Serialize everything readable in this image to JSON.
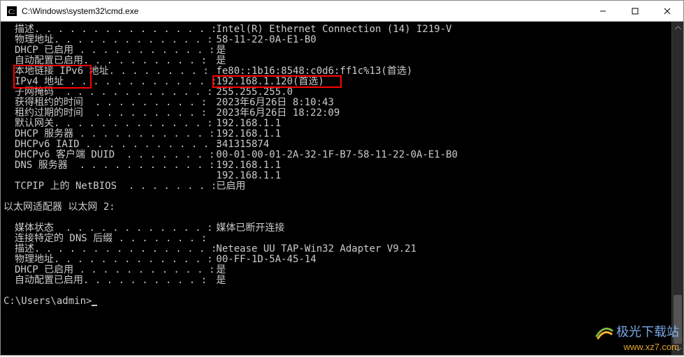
{
  "title": "C:\\Windows\\system32\\cmd.exe",
  "rows": [
    {
      "key": "描述",
      "dots": ". . . . . . . . . . . . . . . :",
      "val": "Intel(R) Ethernet Connection (14) I219-V"
    },
    {
      "key": "物理地址",
      "dots": ". . . . . . . . . . . . . :",
      "val": "58-11-22-0A-E1-B0"
    },
    {
      "key": "DHCP 已启用",
      "dots": " . . . . . . . . . . . :",
      "val": "是"
    },
    {
      "key": "自动配置已启用",
      "dots": ". . . . . . . . . . :",
      "val": "是"
    },
    {
      "key": "本地链接 IPv6 地址",
      "dots": ". . . . . . . . :",
      "val": "fe80::1b16:8548:c0d6:ff1c%13(首选)"
    },
    {
      "key": "IPv4 地址",
      "dots": " . . . . . . . . . . . . :",
      "val": "192.168.1.120(首选)"
    },
    {
      "key": "子网掩码",
      "dots": "  . . . . . . . . . . . . :",
      "val": "255.255.255.0"
    },
    {
      "key": "获得租约的时间",
      "dots": "  . . . . . . . . . :",
      "val": "2023年6月26日 8:10:43"
    },
    {
      "key": "租约过期的时间",
      "dots": "  . . . . . . . . . :",
      "val": "2023年6月26日 18:22:09"
    },
    {
      "key": "默认网关",
      "dots": ". . . . . . . . . . . . . :",
      "val": "192.168.1.1"
    },
    {
      "key": "DHCP 服务器",
      "dots": " . . . . . . . . . . . :",
      "val": "192.168.1.1"
    },
    {
      "key": "DHCPv6 IAID",
      "dots": " . . . . . . . . . . . :",
      "val": "341315874"
    },
    {
      "key": "DHCPv6 客户端 DUID",
      "dots": "  . . . . . . . :",
      "val": "00-01-00-01-2A-32-1F-B7-58-11-22-0A-E1-B0"
    },
    {
      "key": "DNS 服务器",
      "dots": "  . . . . . . . . . . . :",
      "val": "192.168.1.1"
    },
    {
      "key": "",
      "dots": "",
      "val": "192.168.1.1",
      "continuation": true
    },
    {
      "key": "TCPIP 上的 NetBIOS",
      "dots": "  . . . . . . . :",
      "val": "已启用"
    }
  ],
  "section2": "以太网适配器 以太网 2:",
  "rows2": [
    {
      "key": "媒体状态",
      "dots": "  . . . . . . . . . . . . :",
      "val": "媒体已断开连接"
    },
    {
      "key": "连接特定的 DNS 后缀",
      "dots": " . . . . . . . :",
      "val": ""
    },
    {
      "key": "描述",
      "dots": ". . . . . . . . . . . . . . . :",
      "val": "Netease UU TAP-Win32 Adapter V9.21"
    },
    {
      "key": "物理地址",
      "dots": ". . . . . . . . . . . . . :",
      "val": "00-FF-1D-5A-45-14"
    },
    {
      "key": "DHCP 已启用",
      "dots": " . . . . . . . . . . . :",
      "val": "是"
    },
    {
      "key": "自动配置已启用",
      "dots": ". . . . . . . . . . :",
      "val": "是"
    }
  ],
  "prompt": "C:\\Users\\admin>",
  "watermark": {
    "line1": "极光下载站",
    "line2": "www.xz7.com"
  }
}
